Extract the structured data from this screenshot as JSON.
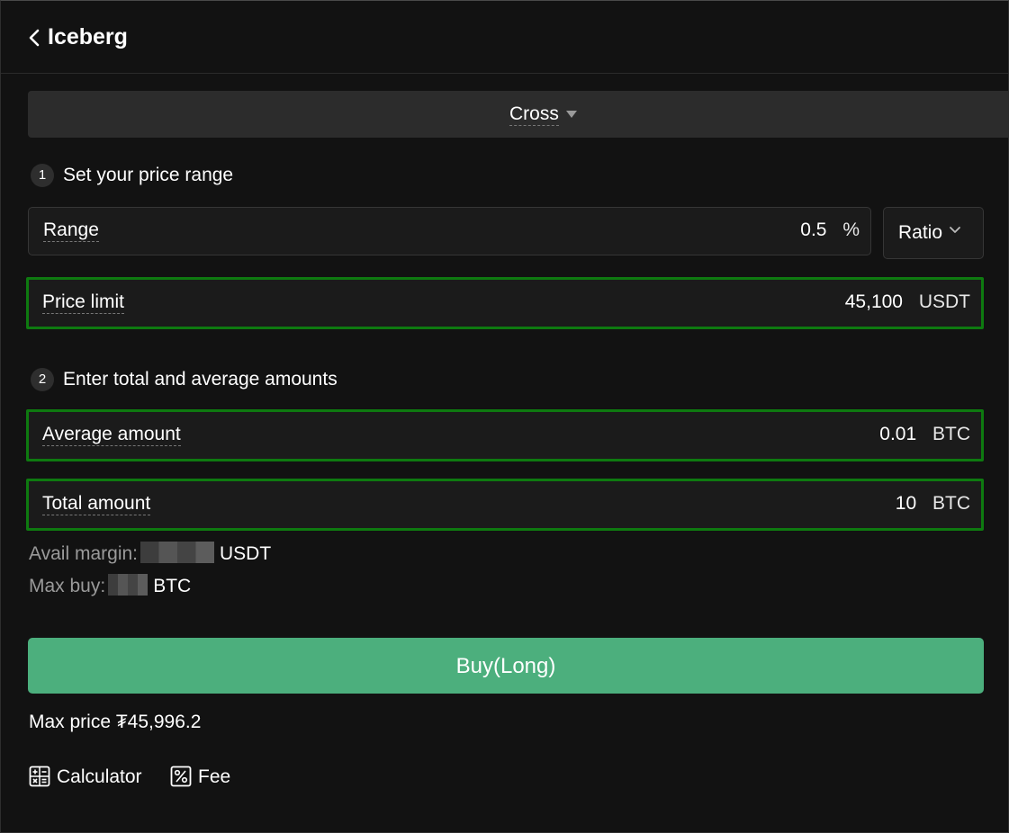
{
  "header": {
    "title": "Iceberg",
    "back_icon": "chevron-left-icon"
  },
  "margin_mode": {
    "label": "Cross",
    "icon": "caret-down-icon"
  },
  "step1": {
    "number": "1",
    "text": "Set your price range"
  },
  "range_field": {
    "label": "Range",
    "value": "0.5",
    "unit": "%"
  },
  "ratio_select": {
    "label": "Ratio",
    "icon": "chevron-down-icon"
  },
  "price_limit_field": {
    "label": "Price limit",
    "value": "45,100",
    "unit": "USDT"
  },
  "step2": {
    "number": "2",
    "text": "Enter total and average amounts"
  },
  "average_amount_field": {
    "label": "Average amount",
    "value": "0.01",
    "unit": "BTC"
  },
  "total_amount_field": {
    "label": "Total amount",
    "value": "10",
    "unit": "BTC"
  },
  "avail_margin": {
    "label": "Avail margin:",
    "unit": "USDT"
  },
  "max_buy": {
    "label": "Max buy:",
    "unit": "BTC"
  },
  "buy_button": {
    "label": "Buy(Long)"
  },
  "max_price": {
    "text": "Max price ₮45,996.2"
  },
  "tools": {
    "calculator_label": "Calculator",
    "calculator_icon": "calculator-icon",
    "fee_label": "Fee",
    "fee_icon": "percent-icon"
  },
  "colors": {
    "background": "#121212",
    "field_background": "#1b1b1b",
    "highlight_border": "#0e7a10",
    "buy_button": "#4caf7d",
    "muted_text": "#9a9a9a"
  }
}
